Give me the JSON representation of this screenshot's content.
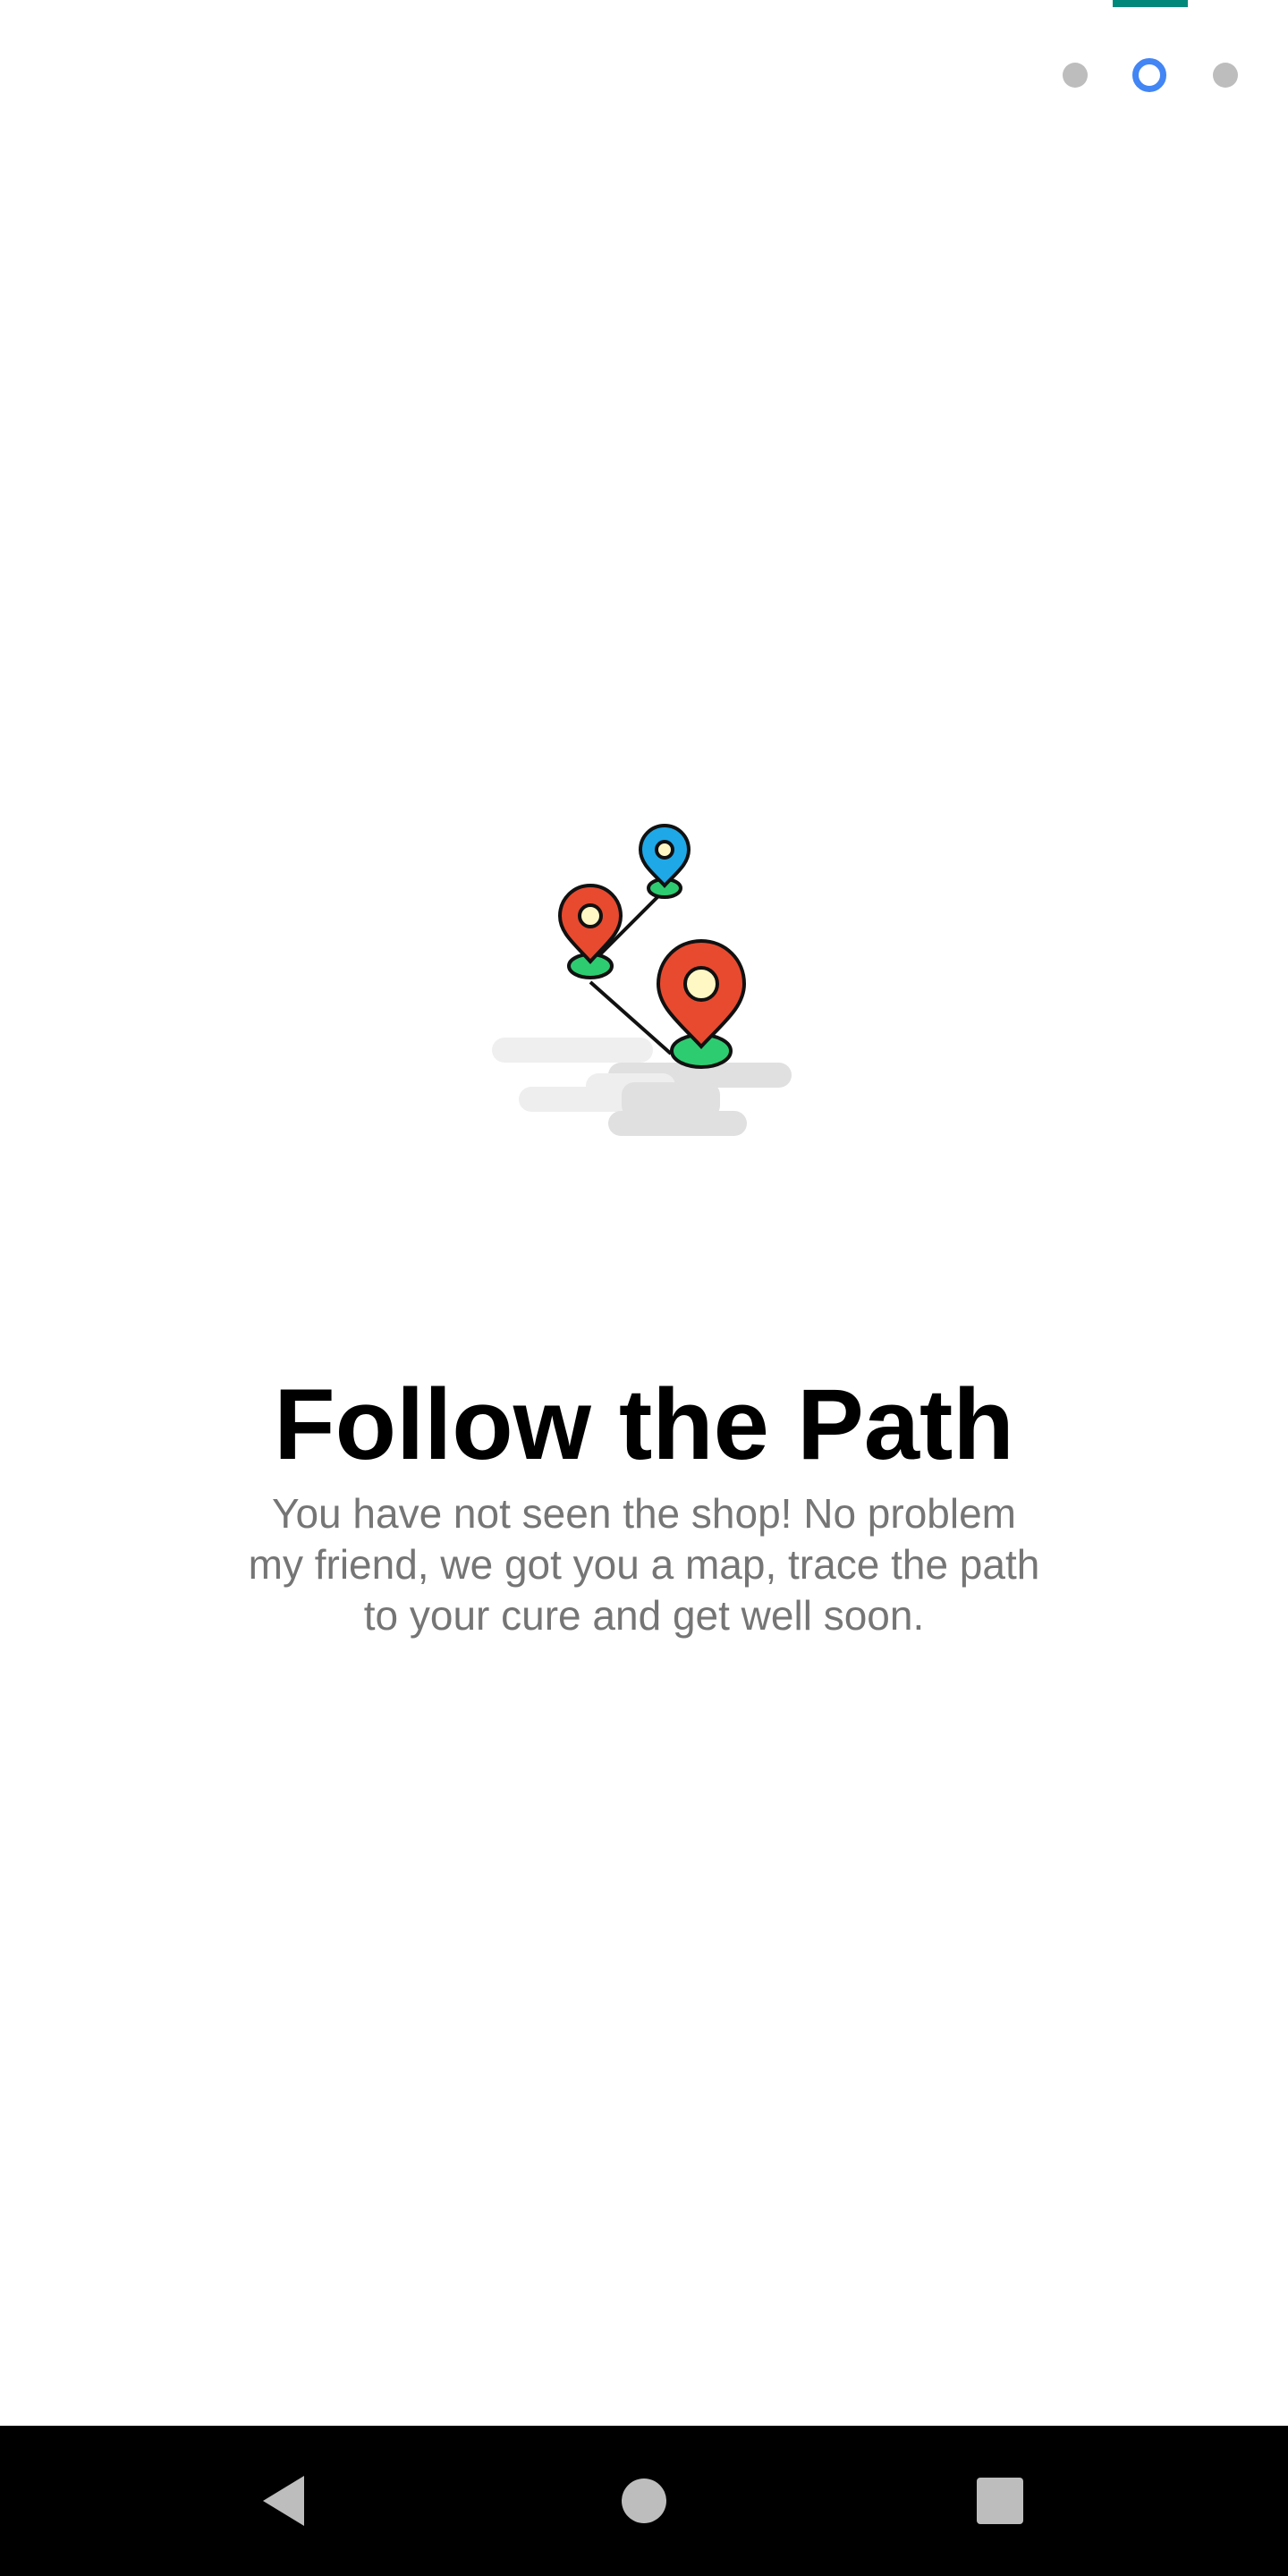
{
  "pager": {
    "page_count": 3,
    "active_index": 1,
    "colors": {
      "active": "#4285f4",
      "inactive": "#bdbdbd",
      "top_bar": "#00897b"
    }
  },
  "onboarding": {
    "illustration_icon": "map-path-pins-icon",
    "title": "Follow the Path",
    "description": "You have not seen the shop! No problem my friend, we got you a map, trace the path to your cure and get well soon."
  },
  "navigation_bar": {
    "back_icon": "back-triangle-icon",
    "home_icon": "home-circle-icon",
    "recents_icon": "recents-square-icon"
  }
}
